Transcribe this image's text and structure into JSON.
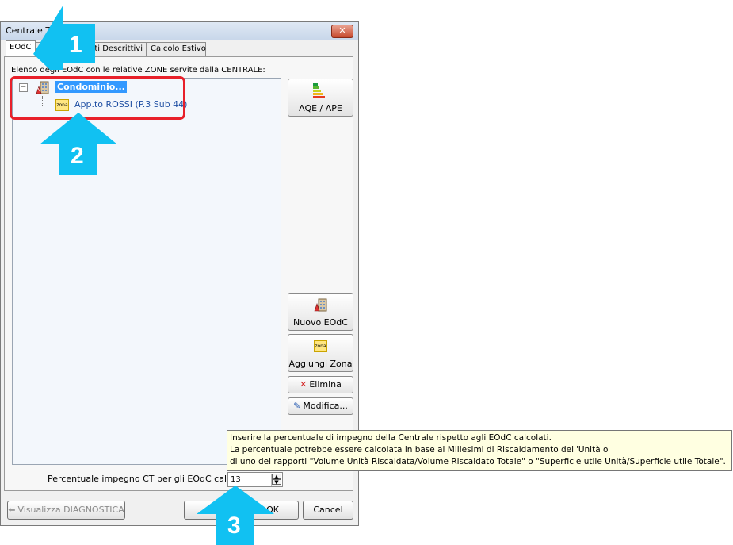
{
  "window": {
    "title": "Centrale T",
    "close_glyph": "✕"
  },
  "tabs": [
    {
      "label": "EOdC"
    },
    {
      "label": "ti Descrittivi"
    },
    {
      "label": "Calcolo Estivo"
    }
  ],
  "list_label": "Elenco degli EOdC con le relative ZONE servite dalla CENTRALE:",
  "tree": {
    "expander": "−",
    "root_label": "Condominio...",
    "child_label": "App.to ROSSI (P.3 Sub 44)",
    "zona_icon_text": "zona"
  },
  "side_buttons": {
    "aqe_label": "AQE / APE",
    "nuovo_label": "Nuovo EOdC",
    "aggiungi_label": "Aggiungi Zona",
    "elimina_label": "Elimina",
    "modifica_label": "Modifica...",
    "zona_icon_text": "zona"
  },
  "percent": {
    "label": "Percentuale impegno CT per gli EOdC calcolati",
    "value": "13"
  },
  "tooltip": {
    "line1": "Inserire la percentuale di impegno della Centrale rispetto agli EOdC calcolati.",
    "line2": "La percentuale potrebbe essere calcolata in base ai Millesimi di Riscaldamento dell'Unità o",
    "line3": "di uno dei rapporti \"Volume Unità Riscaldata/Volume Riscaldato Totale\" o \"Superficie utile Unità/Superficie utile Totale\"."
  },
  "bottom_buttons": {
    "diagnostica_label": "Visualizza DIAGNOSTICA",
    "ok_label": "OK",
    "cancel_label": "Cancel"
  },
  "callouts": {
    "one": "1",
    "two": "2",
    "three": "3"
  },
  "colors": {
    "callout": "#11c1f2",
    "highlight": "#e8202a",
    "selection": "#3399ff"
  }
}
